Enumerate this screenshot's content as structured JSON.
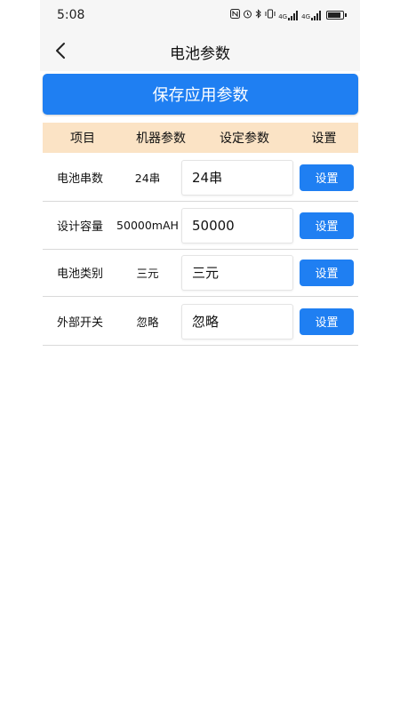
{
  "status_bar": {
    "time": "5:08",
    "icons": [
      "nfc-icon",
      "alarm-icon",
      "bluetooth-icon",
      "vibrate-icon",
      "4g-signal-icon",
      "4g-signal-icon",
      "battery-charging-icon"
    ],
    "net_label_1": "4G",
    "net_label_2": "4G"
  },
  "header": {
    "title": "电池参数"
  },
  "save_button": {
    "label": "保存应用参数",
    "color": "#1f7ff2"
  },
  "table": {
    "headers": [
      "项目",
      "机器参数",
      "设定参数",
      "设置"
    ],
    "header_bg": "#fbe3c5",
    "rows": [
      {
        "item": "电池串数",
        "machine": "24串",
        "setting": "24串",
        "button": "设置"
      },
      {
        "item": "设计容量",
        "machine": "50000mAH",
        "setting": "50000",
        "button": "设置"
      },
      {
        "item": "电池类别",
        "machine": "三元",
        "setting": "三元",
        "button": "设置"
      },
      {
        "item": "外部开关",
        "machine": "忽略",
        "setting": "忽略",
        "button": "设置"
      }
    ]
  }
}
